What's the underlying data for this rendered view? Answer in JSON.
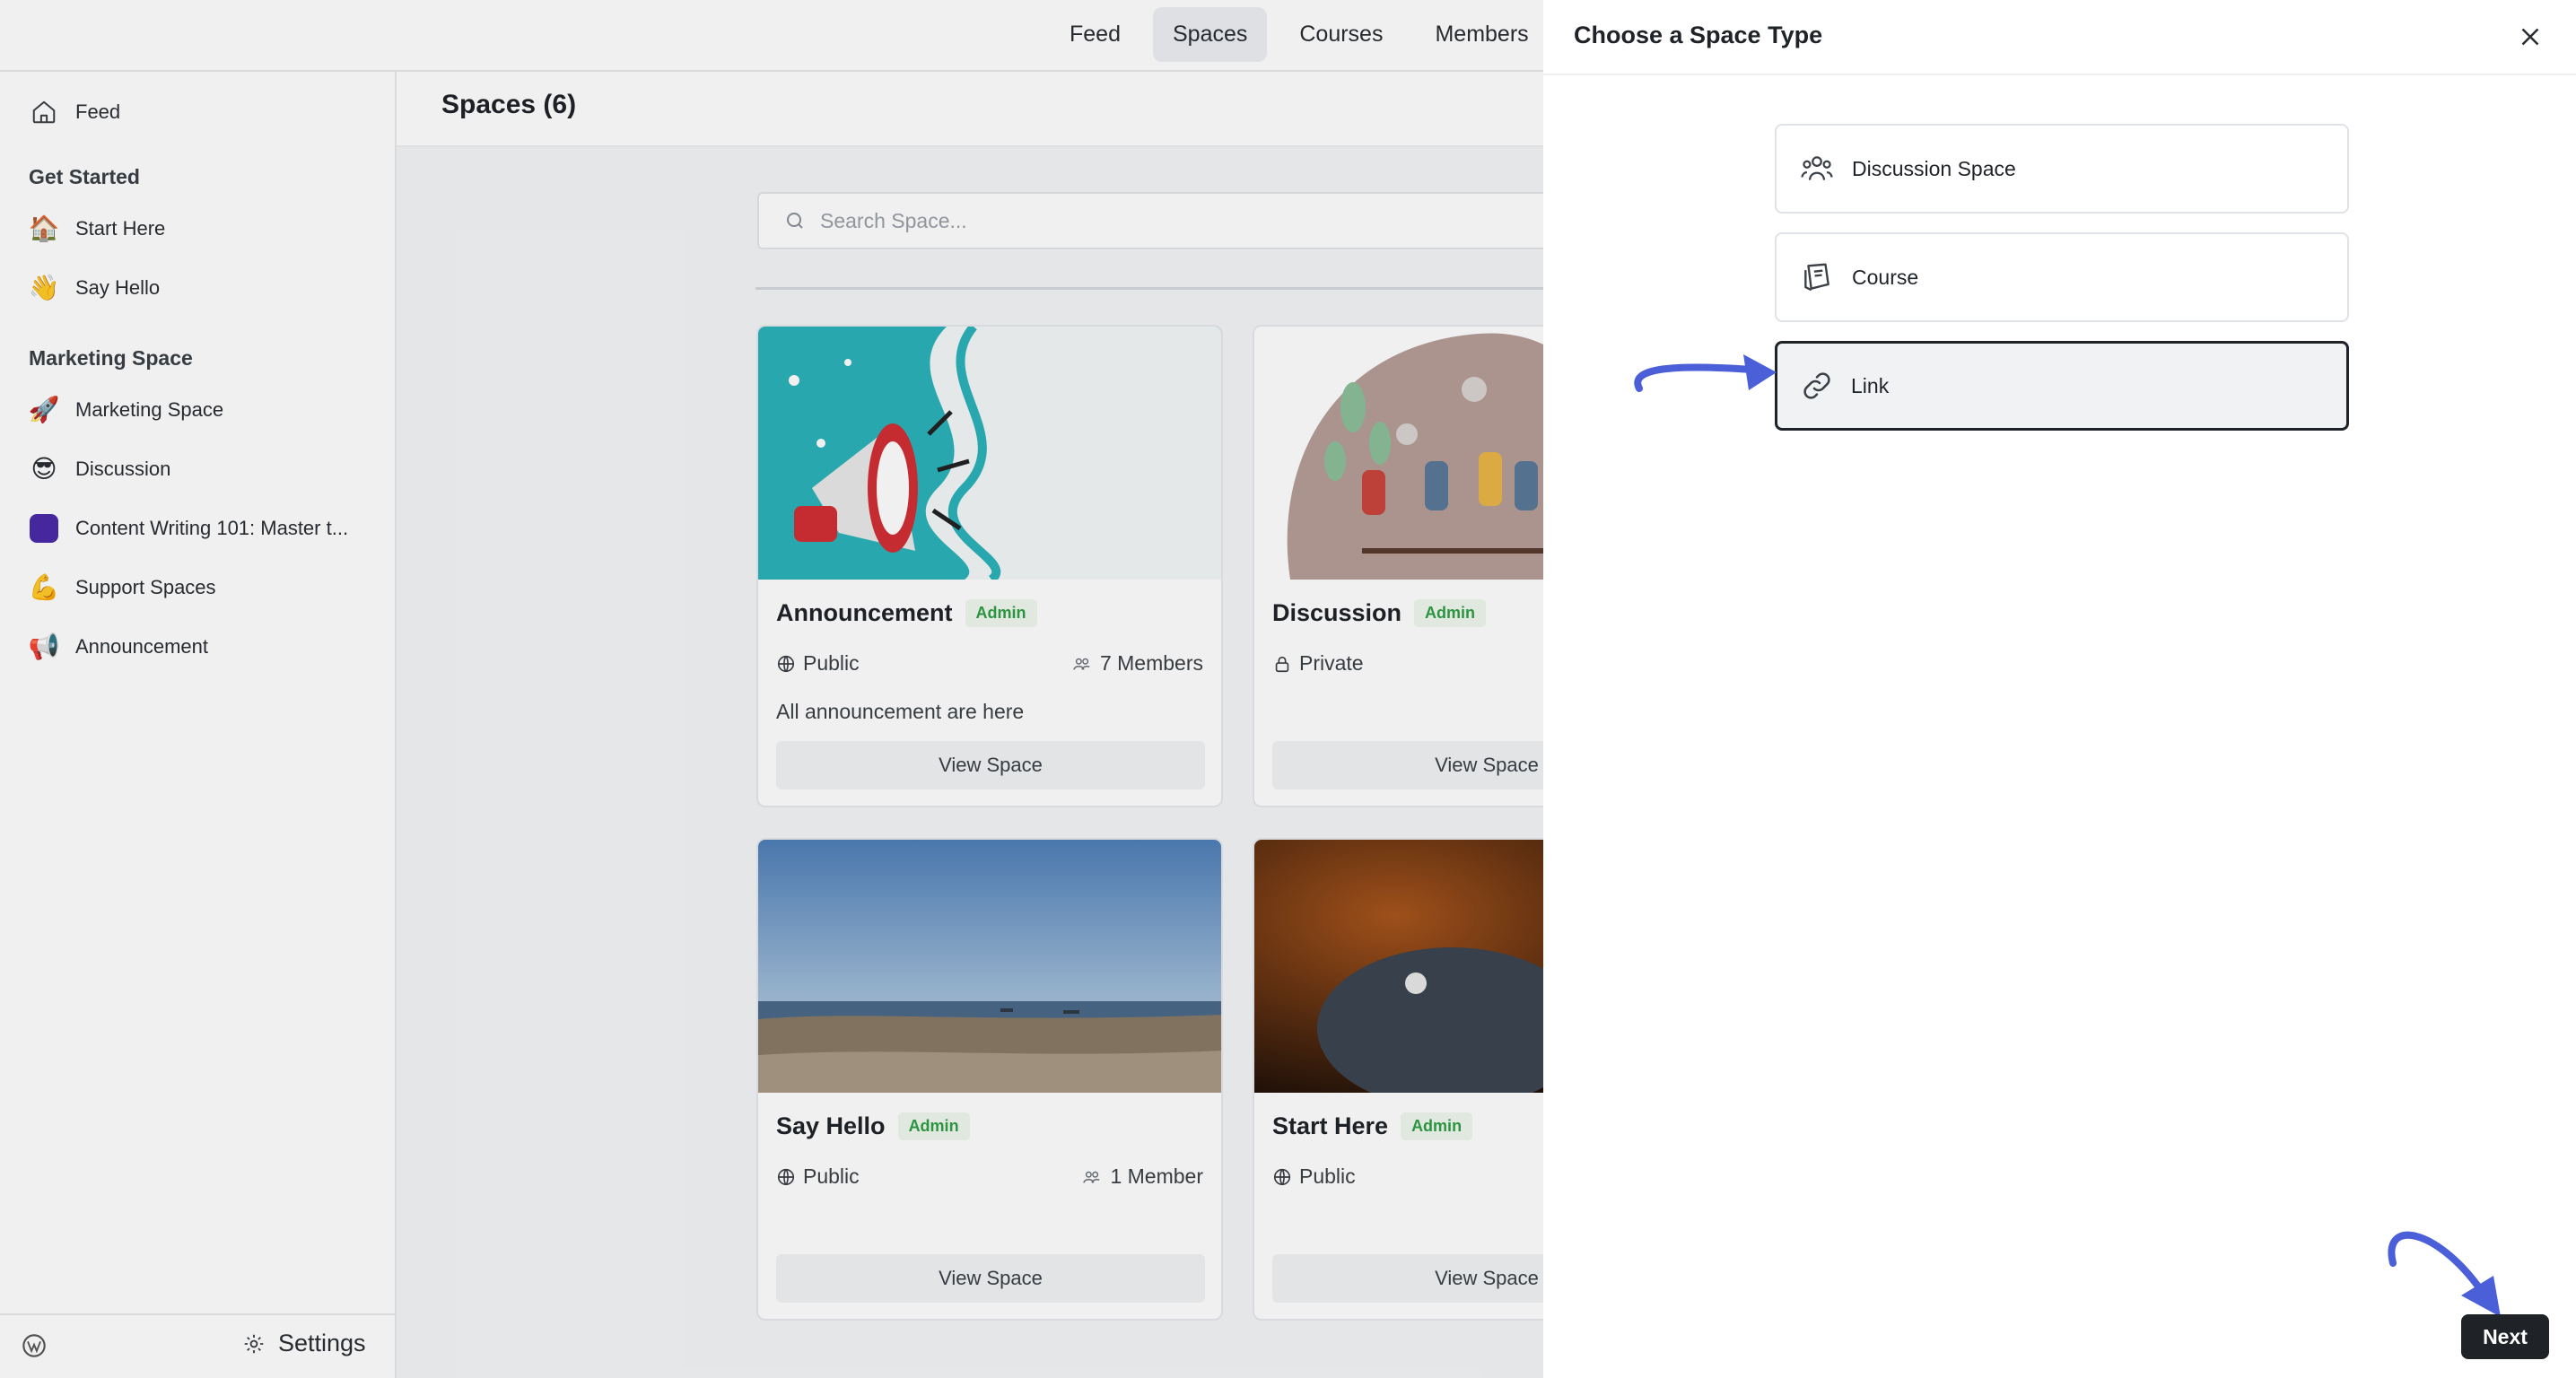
{
  "topnav": {
    "tabs": [
      "Feed",
      "Spaces",
      "Courses",
      "Members"
    ],
    "active": "Spaces"
  },
  "sidebar": {
    "feed_label": "Feed",
    "sections": [
      {
        "heading": "Get Started",
        "items": [
          {
            "icon": "house-emoji",
            "glyph": "🏠",
            "label": "Start Here"
          },
          {
            "icon": "waving-hand-emoji",
            "glyph": "👋",
            "label": "Say Hello"
          }
        ]
      },
      {
        "heading": "Marketing Space",
        "items": [
          {
            "icon": "rocket-emoji",
            "glyph": "🚀",
            "label": "Marketing Space"
          },
          {
            "icon": "sunglasses-emoji",
            "glyph": "😎",
            "label": "Discussion"
          },
          {
            "icon": "purple-square-icon",
            "glyph": "",
            "label": "Content Writing 101: Master t..."
          },
          {
            "icon": "flexed-biceps-emoji",
            "glyph": "💪",
            "label": "Support Spaces"
          },
          {
            "icon": "megaphone-emoji",
            "glyph": "📢",
            "label": "Announcement"
          }
        ]
      }
    ],
    "footer": {
      "settings_label": "Settings"
    }
  },
  "main": {
    "title": "Spaces (6)",
    "search_placeholder": "Search Space...",
    "cards": [
      {
        "title": "Announcement",
        "badge": "Admin",
        "privacy": "Public",
        "members": "7 Members",
        "description": "All announcement are here",
        "button": "View Space"
      },
      {
        "title": "Discussion",
        "badge": "Admin",
        "privacy": "Private",
        "members": "",
        "description": "",
        "button": "View Space"
      },
      {
        "title": "Say Hello",
        "badge": "Admin",
        "privacy": "Public",
        "members": "1 Member",
        "description": "",
        "button": "View Space"
      },
      {
        "title": "Start Here",
        "badge": "Admin",
        "privacy": "Public",
        "members": "",
        "description": "",
        "button": "View Space"
      }
    ]
  },
  "panel": {
    "title": "Choose a Space Type",
    "options": [
      {
        "icon": "people-icon",
        "label": "Discussion Space",
        "selected": false
      },
      {
        "icon": "course-icon",
        "label": "Course",
        "selected": false
      },
      {
        "icon": "link-icon",
        "label": "Link",
        "selected": true
      }
    ],
    "next_label": "Next"
  },
  "colors": {
    "accent_arrow": "#4a5fd8",
    "admin_badge": "#2f9e44",
    "selected_border": "#1f2328"
  }
}
